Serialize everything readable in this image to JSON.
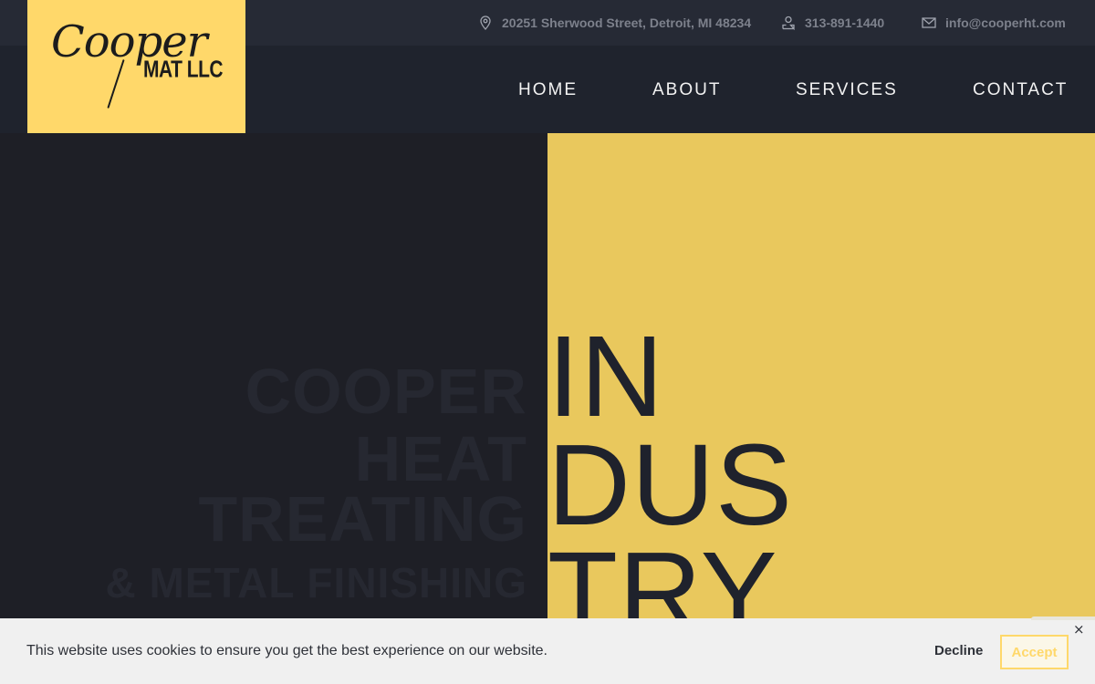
{
  "logo": {
    "script": "Cooper",
    "sub": "MAT LLC"
  },
  "topbar": {
    "address": "20251 Sherwood Street, Detroit, MI 48234",
    "phone": "313-891-1440",
    "email": "info@cooperht.com",
    "icons": {
      "address": "map-pin-icon",
      "phone": "phone-person-icon",
      "email": "envelope-icon"
    }
  },
  "nav": {
    "home": "HOME",
    "about": "ABOUT",
    "services": "SERVICES",
    "contact": "CONTACT"
  },
  "hero": {
    "ghost_lines": [
      "COOPER",
      "HEAT",
      "TREATING",
      "& METAL FINISHING"
    ],
    "big_words": [
      "IN",
      "DUS",
      "TRY"
    ]
  },
  "cookie": {
    "message": "This website uses cookies to ensure you get the best experience on our website.",
    "decline": "Decline",
    "accept": "Accept",
    "close": "×"
  },
  "colors": {
    "accent": "#ffd86a",
    "hero_yellow": "#e9c85d",
    "dark": "#1e1f26"
  }
}
